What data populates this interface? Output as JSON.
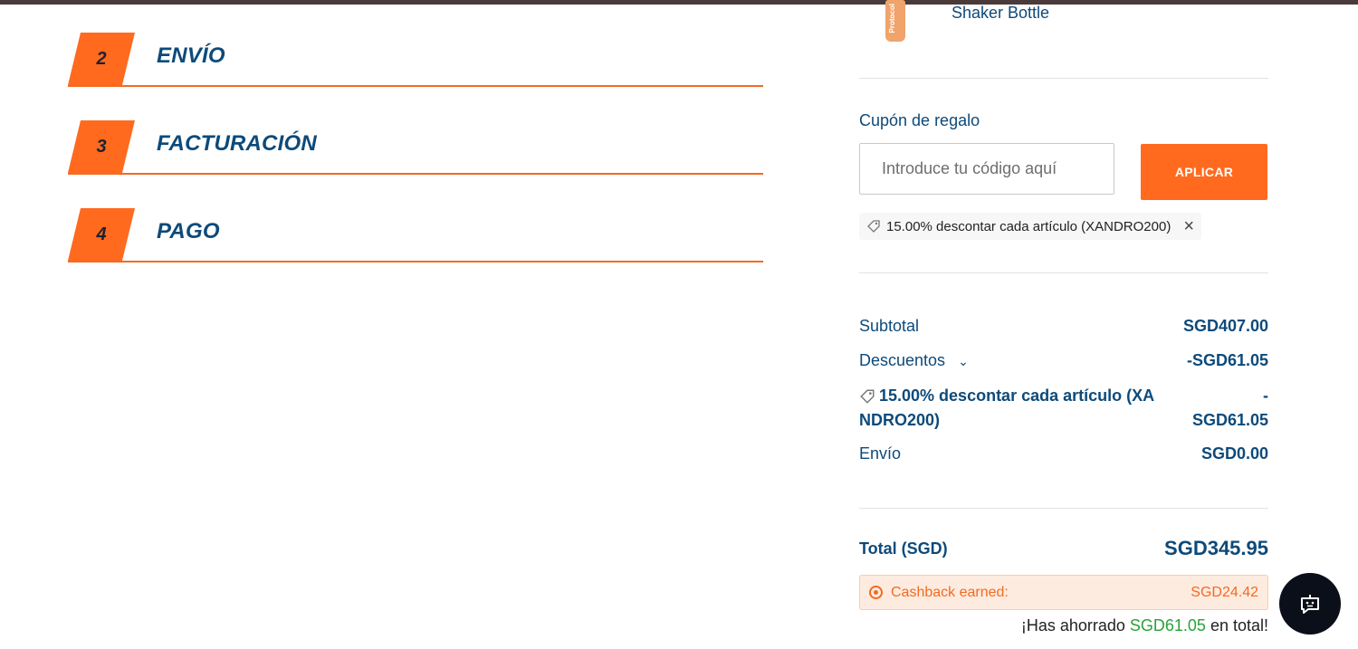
{
  "steps": [
    {
      "number": "2",
      "title": "ENVÍO"
    },
    {
      "number": "3",
      "title": "FACTURACIÓN"
    },
    {
      "number": "4",
      "title": "PAGO"
    }
  ],
  "product": {
    "name": "Shaker Bottle",
    "thumb_text": "Protocol"
  },
  "coupon": {
    "label": "Cupón de regalo",
    "placeholder": "Introduce tu código aquí",
    "apply_label": "APLICAR",
    "applied_text": "15.00% descontar cada artículo (XANDRO200)"
  },
  "summary": {
    "subtotal_label": "Subtotal",
    "subtotal_value": "SGD407.00",
    "discounts_label": "Descuentos",
    "discounts_value": "-SGD61.05",
    "discount_detail_line1": "15.00% descontar cada artículo (XA",
    "discount_detail_line2": "NDRO200)",
    "discount_detail_value_line1": "-",
    "discount_detail_value_line2": "SGD61.05",
    "shipping_label": "Envío",
    "shipping_value": "SGD0.00",
    "total_label": "Total (SGD)",
    "total_value": "SGD345.95"
  },
  "cashback": {
    "label": "Cashback earned:",
    "value": "SGD24.42"
  },
  "savings": {
    "prefix": "¡Has ahorrado ",
    "amount": "SGD61.05",
    "suffix": " en total!"
  },
  "colors": {
    "accent": "#ff6a1f",
    "text": "#0d4a7a",
    "savings": "#2aa13a"
  }
}
